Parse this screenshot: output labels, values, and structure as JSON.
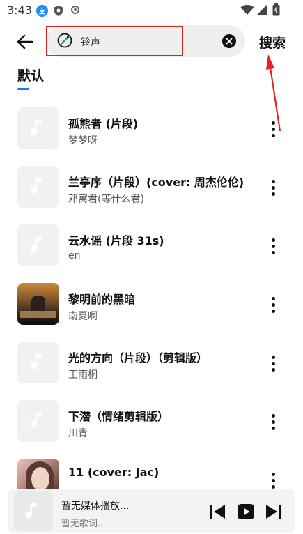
{
  "status_bar": {
    "time": "3:43"
  },
  "search": {
    "query": "铃声",
    "button_label": "搜索"
  },
  "tabs": [
    {
      "label": "默认",
      "selected": true
    }
  ],
  "songs": [
    {
      "title": "孤熊者 (片段)",
      "artist": "梦梦呀",
      "cover": "placeholder-note"
    },
    {
      "title": "兰亭序（片段）(cover: 周杰伦伦)",
      "artist": "邓寓君(等什么君)",
      "cover": "placeholder-note"
    },
    {
      "title": "云水谣 (片段 31s)",
      "artist": "en",
      "cover": "placeholder-note"
    },
    {
      "title": "黎明前的黑暗",
      "artist": "南夏啊",
      "cover": "album-art"
    },
    {
      "title": "光的方向（片段）（剪辑版）",
      "artist": "王雨桐",
      "cover": "placeholder-note"
    },
    {
      "title": "下潜（情绪剪辑版）",
      "artist": "川青",
      "cover": "placeholder-note"
    },
    {
      "title": "11 (cover: Jac)",
      "artist": "",
      "cover": "portrait-photo"
    }
  ],
  "mini_player": {
    "title": "暂无媒体播放...",
    "lyric": "暂无歌词.."
  },
  "colors": {
    "accent": "#1a73ff",
    "annotation_red": "#e02424",
    "text_primary": "#111111",
    "text_secondary": "#555555"
  }
}
